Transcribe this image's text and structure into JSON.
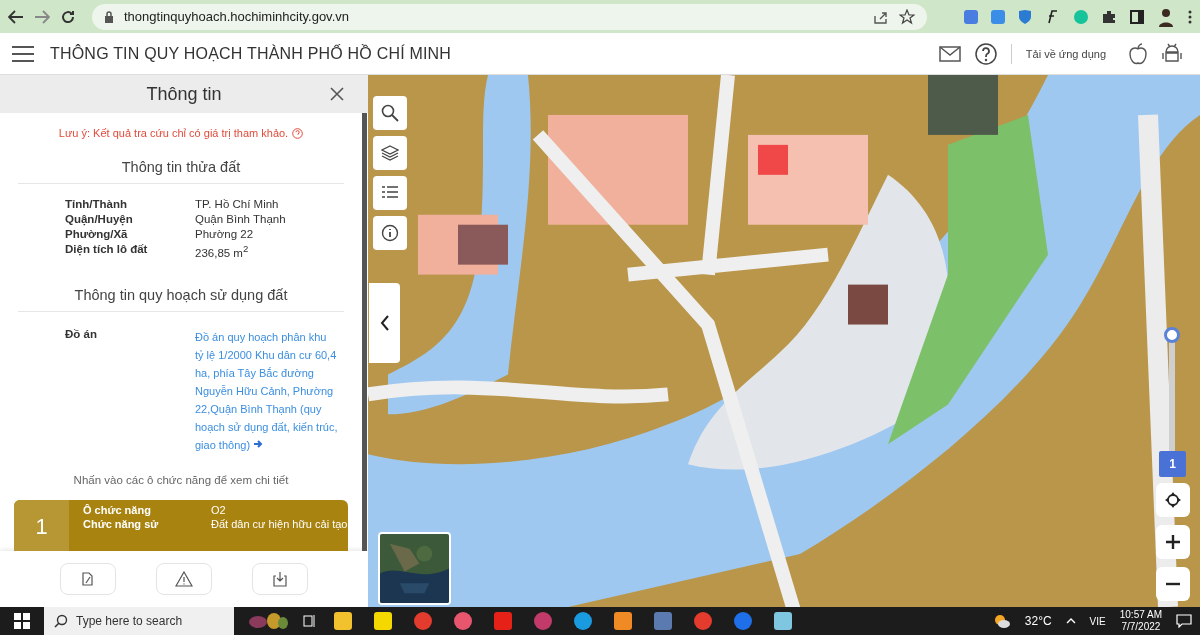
{
  "browser": {
    "url": "thongtinquyhoach.hochiminhcity.gov.vn"
  },
  "header": {
    "title": "THÔNG TIN QUY HOẠCH THÀNH PHỐ HỒ CHÍ MINH",
    "download_label": "Tải về ứng dụng"
  },
  "panel": {
    "title": "Thông tin",
    "notice": "Lưu ý: Kết quả tra cứu chỉ có giá trị tham khảo.",
    "parcel_heading": "Thông tin thửa đất",
    "parcel_rows": [
      {
        "label": "Tỉnh/Thành",
        "value": "TP. Hồ Chí Minh"
      },
      {
        "label": "Quận/Huyện",
        "value": "Quận Bình Thạnh"
      },
      {
        "label": "Phường/Xã",
        "value": "Phường 22"
      },
      {
        "label": "Diện tích lô đất",
        "value": "236,85 m$^{2}$"
      }
    ],
    "plan_heading": "Thông tin quy hoạch sử dụng đất",
    "plan_rows": [
      {
        "label": "Đồ án",
        "value": "Đồ án quy hoạch phân khu tỷ lệ 1/2000 Khu dân cư 60,4 ha, phía Tây Bắc đường Nguyễn Hữu Cảnh, Phường 22,Quận Bình Thạnh (quy hoạch sử dụng đất, kiến trúc, giao thông)"
      }
    ],
    "hint": "Nhấn vào các ô chức năng để xem chi tiết",
    "zones": [
      {
        "number": "1",
        "rows": [
          {
            "label": "Ô chức năng",
            "value": "O2"
          },
          {
            "label": "Chức năng sử",
            "value": "Đất dân cư hiện hữu cải tạo"
          }
        ]
      }
    ]
  },
  "map": {
    "slider": {
      "label": "1",
      "level": 1
    }
  },
  "taskbar": {
    "search_placeholder": "Type here to search",
    "temperature": "32°C",
    "language": "VIE",
    "time": "10:57 AM",
    "date": "7/7/2022"
  }
}
